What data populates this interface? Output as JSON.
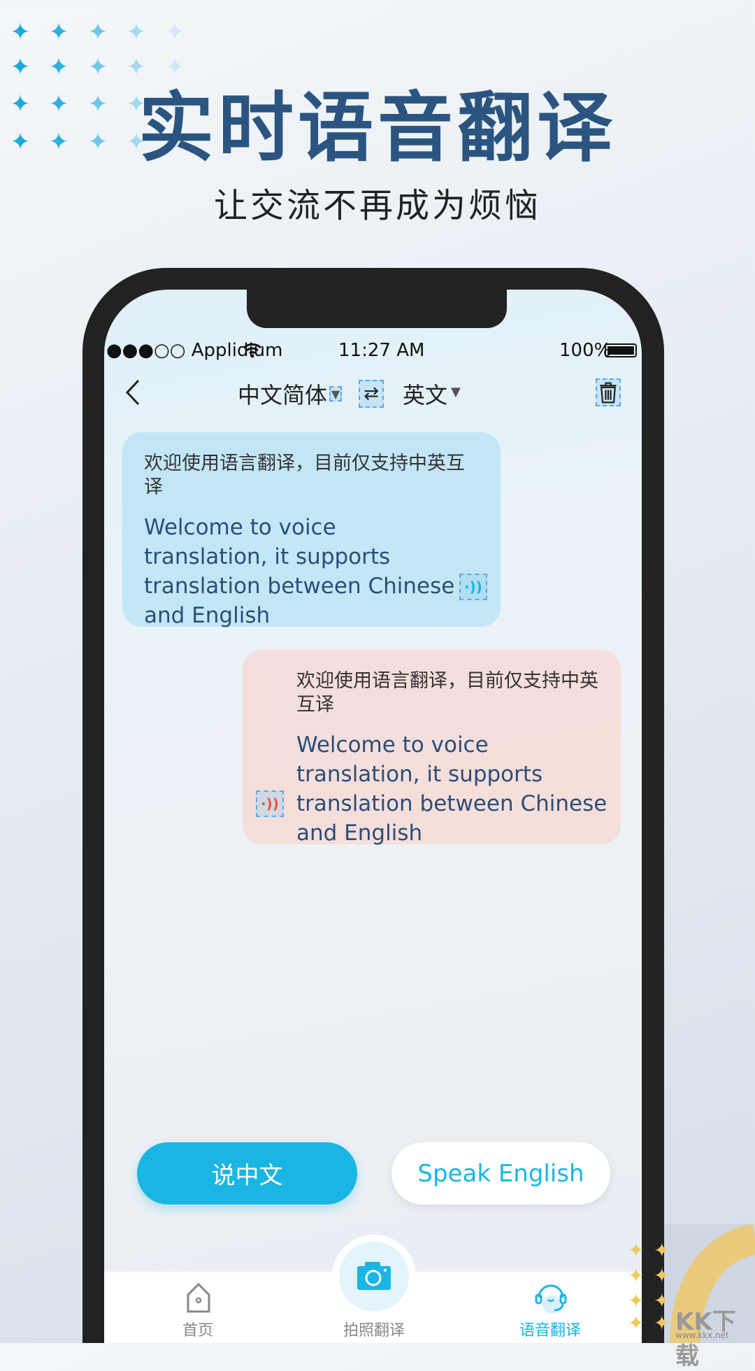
{
  "headline": "实时语音翻译",
  "subheadline": "让交流不再成为烦恼",
  "status_bar": {
    "carrier": "●●●○○ Applidium",
    "time": "11:27 AM",
    "battery": "100%"
  },
  "nav": {
    "source_lang": "中文简体",
    "target_lang": "英文"
  },
  "messages": [
    {
      "zh": "欢迎使用语言翻译，目前仅支持中英互译",
      "en": "Welcome to voice translation, it supports translation between Chinese and English",
      "side": "left"
    },
    {
      "zh": "欢迎使用语言翻译，目前仅支持中英互译",
      "en": "Welcome to voice translation, it supports translation between Chinese and English",
      "side": "right"
    }
  ],
  "buttons": {
    "speak_chinese": "说中文",
    "speak_english": "Speak English"
  },
  "tabs": [
    {
      "label": "首页",
      "icon": "home-icon"
    },
    {
      "label": "拍照翻译",
      "icon": "camera-icon"
    },
    {
      "label": "语音翻译",
      "icon": "headset-icon",
      "active": true
    }
  ],
  "watermark": {
    "text": "KK下载",
    "url": "www.kkx.net"
  },
  "colors": {
    "accent": "#1ab5e3",
    "title": "#2b5580",
    "speaker_left": "#1ab5e3",
    "speaker_right": "#e8553a"
  }
}
